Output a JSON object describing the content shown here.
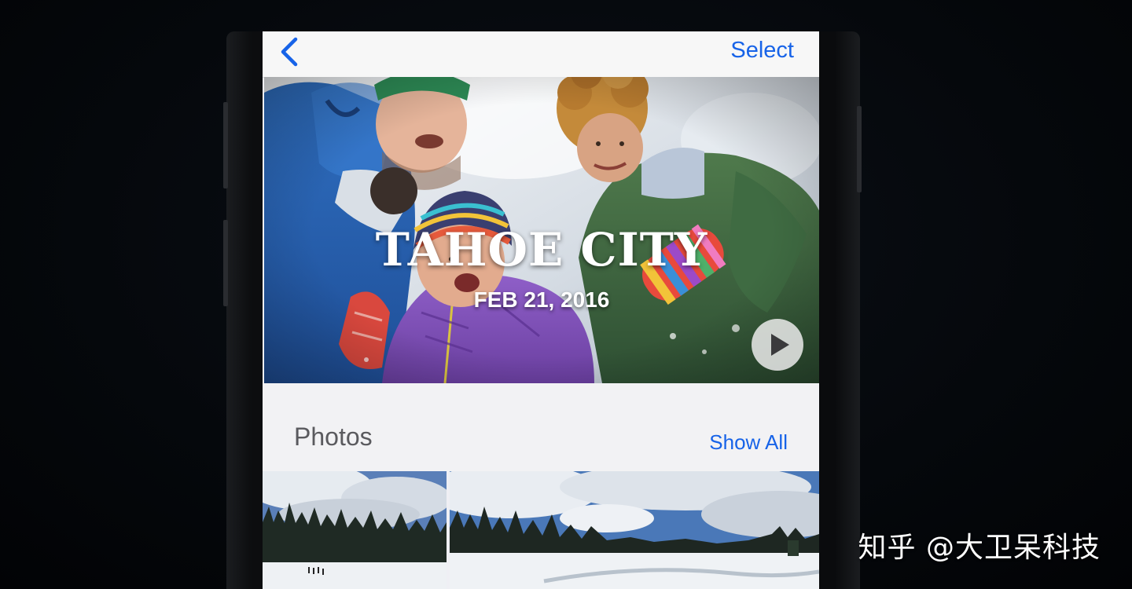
{
  "navbar": {
    "back_icon": "chevron-left-icon",
    "select_label": "Select"
  },
  "memory": {
    "title": "TAHOE CITY",
    "date": "FEB 21, 2016",
    "play_icon": "play-icon"
  },
  "photos_section": {
    "title": "Photos",
    "show_all_label": "Show All",
    "thumbnail_count": 2
  },
  "watermark": {
    "text": "知乎 @大卫呆科技"
  },
  "colors": {
    "accent": "#1763e8",
    "navbar_bg": "#f7f7f7",
    "section_bg": "#f2f2f4"
  }
}
